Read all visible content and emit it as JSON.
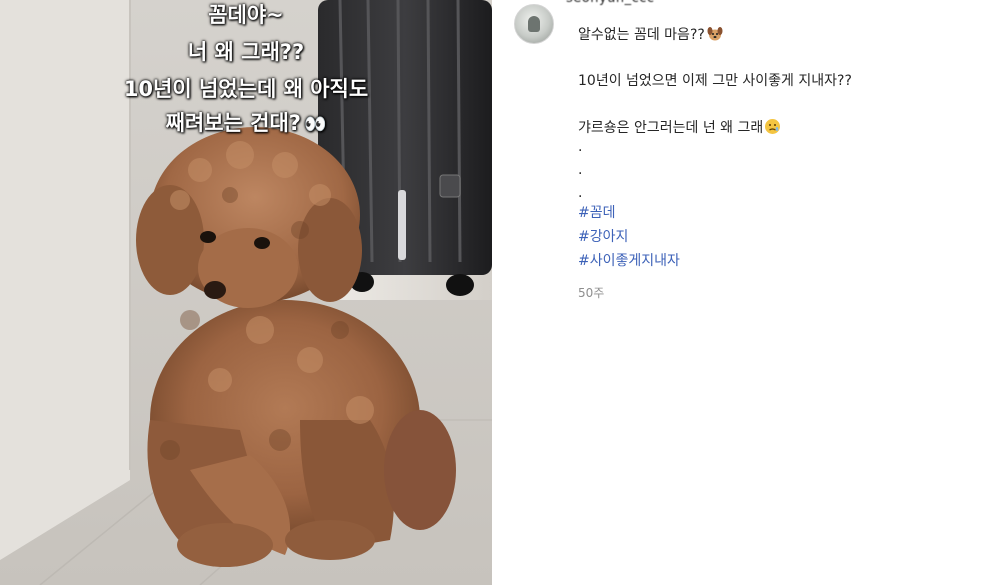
{
  "colors": {
    "hashtag": "#3d62b8",
    "text": "#262626",
    "timestamp": "#8e8e8e",
    "overlay_text": "#ffffff"
  },
  "photo": {
    "overlay_lines": [
      "꼼데야~",
      "너 왜 그래??",
      "10년이 넘었는데 왜 아직도",
      "째려보는 건대?"
    ],
    "eyes_emoji": "👀"
  },
  "post": {
    "username": "seohyun_ccc",
    "caption_lines": [
      "알수없는 꼼데 마음??",
      "10년이 넘었으면 이제 그만 사이좋게 지내자??",
      "갸르숑은 안그러는데 넌 왜 그래"
    ],
    "dots": [
      ".",
      ".",
      "."
    ],
    "hashtags": [
      "#꼼데",
      "#강아지",
      "#사이좋게지내자"
    ],
    "timestamp": "50주",
    "icons": {
      "avatar": "profile-avatar",
      "emoji_1": "dog-face-icon",
      "emoji_2": "worried-face-icon"
    }
  }
}
